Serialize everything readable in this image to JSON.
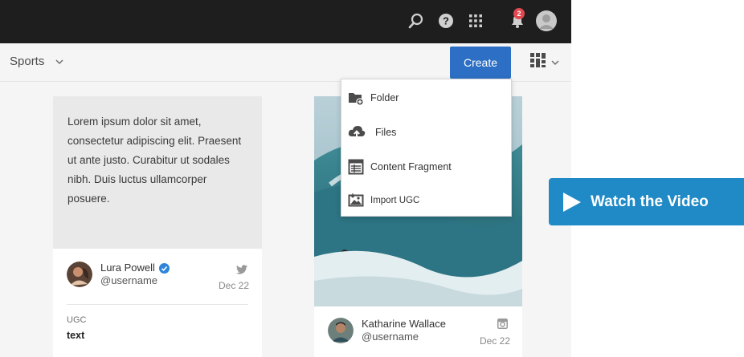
{
  "topbar": {
    "notification_count": "2"
  },
  "breadcrumb": {
    "label": "Sports"
  },
  "toolbar": {
    "create_label": "Create"
  },
  "create_menu": {
    "items": [
      {
        "label": "Folder",
        "icon": "folder-add-icon"
      },
      {
        "label": "Files",
        "icon": "cloud-upload-icon"
      },
      {
        "label": "Content Fragment",
        "icon": "content-fragment-icon"
      },
      {
        "label": "Import UGC",
        "icon": "import-image-icon"
      }
    ]
  },
  "cards": [
    {
      "text": "Lorem ipsum dolor sit amet, consectetur adipiscing elit. Praesent ut ante justo. Curabitur ut sodales nibh. Duis luctus ullamcorper posuere.",
      "author": "Lura Powell",
      "handle": "@username",
      "date": "Dec 22",
      "source_icon": "twitter-icon",
      "type_label": "UGC",
      "type_value": "text"
    },
    {
      "author": "Katharine Wallace",
      "handle": "@username",
      "date": "Dec 22",
      "source_icon": "instagram-icon"
    }
  ],
  "promo": {
    "watch_label": "Watch the Video"
  },
  "colors": {
    "topbar": "#1e1e1e",
    "accent": "#2d6fc4",
    "promo": "#1f8ac6",
    "verified": "#2d86d9",
    "notification": "#e34850"
  }
}
